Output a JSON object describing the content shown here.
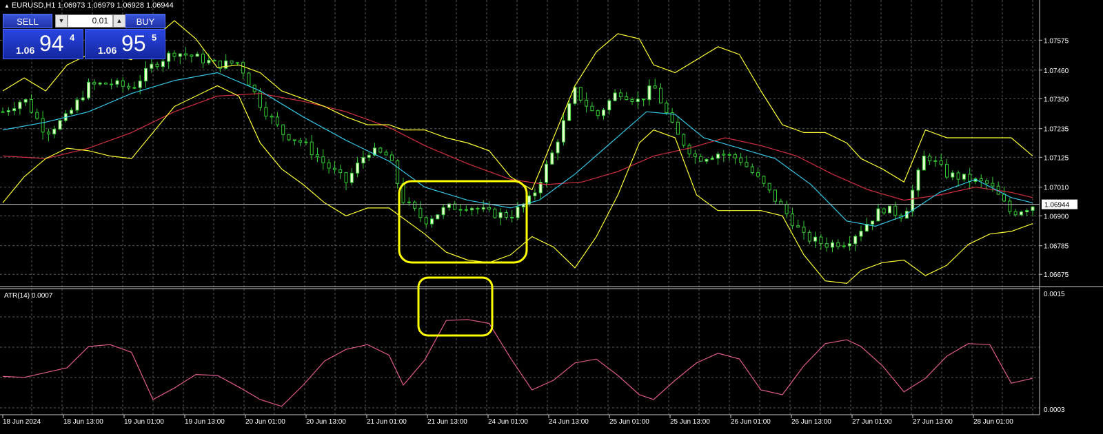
{
  "window": {
    "title": "EURUSD,H1  1.06973 1.06979 1.06928 1.06944",
    "triangle": "▲"
  },
  "trade_panel": {
    "sell_label": "SELL",
    "buy_label": "BUY",
    "lot_value": "0.01",
    "down_arrow": "▼",
    "up_arrow": "▲",
    "sell_price": {
      "prefix": "1.06",
      "big": "94",
      "sup": "4"
    },
    "buy_price": {
      "prefix": "1.06",
      "big": "95",
      "sup": "5"
    }
  },
  "colors": {
    "background": "#000000",
    "grid": "#5a5a5a",
    "bull_candle": "#32cd32",
    "bull_body": "#e8ffd0",
    "bear_candle": "#32cd32",
    "bollinger": "#ffff33",
    "fast_ma": "#33c7e6",
    "slow_ma": "#d42f3f",
    "atr_line": "#e05a8f",
    "highlight_box": "#ffff00",
    "price_line": "#c0c0c0"
  },
  "chart_data": [
    {
      "type": "candlestick",
      "symbol": "EURUSD",
      "timeframe": "H1",
      "ylim": [
        1.0662,
        1.0765
      ],
      "y_ticks": [
        "1.07575",
        "1.07460",
        "1.07350",
        "1.07235",
        "1.07125",
        "1.07010",
        "1.06900",
        "1.06785",
        "1.06675"
      ],
      "current_price": "1.06944",
      "x_ticks": [
        "18 Jun 2024",
        "18 Jun 13:00",
        "19 Jun 01:00",
        "19 Jun 13:00",
        "20 Jun 01:00",
        "20 Jun 13:00",
        "21 Jun 01:00",
        "21 Jun 13:00",
        "24 Jun 01:00",
        "24 Jun 13:00",
        "25 Jun 01:00",
        "25 Jun 13:00",
        "26 Jun 01:00",
        "26 Jun 13:00",
        "27 Jun 01:00",
        "27 Jun 13:00",
        "28 Jun 01:00"
      ],
      "close_path": [
        [
          0,
          1.073
        ],
        [
          6,
          1.0735
        ],
        [
          12,
          1.0722
        ],
        [
          18,
          1.0728
        ],
        [
          24,
          1.074
        ],
        [
          30,
          1.0741
        ],
        [
          36,
          1.0739
        ],
        [
          42,
          1.0748
        ],
        [
          48,
          1.0753
        ],
        [
          54,
          1.0751
        ],
        [
          60,
          1.0748
        ],
        [
          66,
          1.0749
        ],
        [
          72,
          1.0733
        ],
        [
          78,
          1.0722
        ],
        [
          84,
          1.0718
        ],
        [
          90,
          1.071
        ],
        [
          96,
          1.0703
        ],
        [
          102,
          1.0715
        ],
        [
          108,
          1.0713
        ],
        [
          112,
          1.0696
        ],
        [
          118,
          1.0688
        ],
        [
          124,
          1.0693
        ],
        [
          130,
          1.0694
        ],
        [
          136,
          1.0691
        ],
        [
          142,
          1.069
        ],
        [
          148,
          1.0697
        ],
        [
          154,
          1.0715
        ],
        [
          160,
          1.0738
        ],
        [
          166,
          1.0728
        ],
        [
          172,
          1.0738
        ],
        [
          178,
          1.0734
        ],
        [
          182,
          1.074
        ],
        [
          188,
          1.0722
        ],
        [
          194,
          1.0712
        ],
        [
          200,
          1.0714
        ],
        [
          206,
          1.0712
        ],
        [
          212,
          1.0703
        ],
        [
          218,
          1.0693
        ],
        [
          224,
          1.0682
        ],
        [
          230,
          1.0679
        ],
        [
          236,
          1.068
        ],
        [
          240,
          1.0685
        ],
        [
          246,
          1.0693
        ],
        [
          252,
          1.069
        ],
        [
          258,
          1.0714
        ],
        [
          264,
          1.0706
        ],
        [
          270,
          1.0704
        ],
        [
          276,
          1.0702
        ],
        [
          282,
          1.0691
        ],
        [
          288,
          1.0694
        ]
      ],
      "bollinger_upper_path": [
        [
          0,
          1.0738
        ],
        [
          6,
          1.0743
        ],
        [
          12,
          1.0738
        ],
        [
          18,
          1.0748
        ],
        [
          24,
          1.0752
        ],
        [
          30,
          1.0752
        ],
        [
          36,
          1.075
        ],
        [
          42,
          1.0758
        ],
        [
          48,
          1.0765
        ],
        [
          54,
          1.0758
        ],
        [
          60,
          1.0747
        ],
        [
          66,
          1.0748
        ],
        [
          72,
          1.0745
        ],
        [
          78,
          1.0738
        ],
        [
          84,
          1.0735
        ],
        [
          90,
          1.0732
        ],
        [
          96,
          1.0728
        ],
        [
          102,
          1.0725
        ],
        [
          108,
          1.0725
        ],
        [
          112,
          1.0723
        ],
        [
          118,
          1.0723
        ],
        [
          124,
          1.072
        ],
        [
          130,
          1.0718
        ],
        [
          136,
          1.0715
        ],
        [
          142,
          1.0705
        ],
        [
          148,
          1.07
        ],
        [
          154,
          1.072
        ],
        [
          160,
          1.074
        ],
        [
          166,
          1.0753
        ],
        [
          172,
          1.076
        ],
        [
          178,
          1.0758
        ],
        [
          182,
          1.0748
        ],
        [
          188,
          1.0745
        ],
        [
          194,
          1.075
        ],
        [
          200,
          1.0755
        ],
        [
          206,
          1.0752
        ],
        [
          212,
          1.0738
        ],
        [
          218,
          1.0725
        ],
        [
          224,
          1.0722
        ],
        [
          230,
          1.0722
        ],
        [
          236,
          1.0718
        ],
        [
          240,
          1.0712
        ],
        [
          246,
          1.0708
        ],
        [
          252,
          1.0703
        ],
        [
          258,
          1.0723
        ],
        [
          264,
          1.072
        ],
        [
          270,
          1.072
        ],
        [
          276,
          1.072
        ],
        [
          282,
          1.072
        ],
        [
          288,
          1.0713
        ]
      ],
      "bollinger_lower_path": [
        [
          0,
          1.0695
        ],
        [
          6,
          1.0705
        ],
        [
          12,
          1.0712
        ],
        [
          18,
          1.0716
        ],
        [
          24,
          1.0715
        ],
        [
          30,
          1.0713
        ],
        [
          36,
          1.0712
        ],
        [
          42,
          1.0722
        ],
        [
          48,
          1.0732
        ],
        [
          54,
          1.0736
        ],
        [
          60,
          1.074
        ],
        [
          66,
          1.0736
        ],
        [
          72,
          1.0718
        ],
        [
          78,
          1.0708
        ],
        [
          84,
          1.0702
        ],
        [
          90,
          1.0695
        ],
        [
          96,
          1.069
        ],
        [
          102,
          1.0693
        ],
        [
          108,
          1.0693
        ],
        [
          112,
          1.0689
        ],
        [
          118,
          1.0683
        ],
        [
          124,
          1.0676
        ],
        [
          130,
          1.0673
        ],
        [
          136,
          1.0672
        ],
        [
          142,
          1.0675
        ],
        [
          148,
          1.0682
        ],
        [
          154,
          1.0678
        ],
        [
          160,
          1.067
        ],
        [
          166,
          1.0682
        ],
        [
          172,
          1.0698
        ],
        [
          178,
          1.0718
        ],
        [
          182,
          1.0723
        ],
        [
          188,
          1.072
        ],
        [
          194,
          1.0698
        ],
        [
          200,
          1.0692
        ],
        [
          206,
          1.0692
        ],
        [
          212,
          1.0692
        ],
        [
          218,
          1.069
        ],
        [
          224,
          1.0675
        ],
        [
          230,
          1.0665
        ],
        [
          236,
          1.0664
        ],
        [
          240,
          1.0669
        ],
        [
          246,
          1.0672
        ],
        [
          252,
          1.0673
        ],
        [
          258,
          1.0667
        ],
        [
          264,
          1.0671
        ],
        [
          270,
          1.0679
        ],
        [
          276,
          1.0683
        ],
        [
          282,
          1.0684
        ],
        [
          288,
          1.0687
        ]
      ],
      "fast_ma_path": [
        [
          0,
          1.0723
        ],
        [
          12,
          1.0726
        ],
        [
          24,
          1.073
        ],
        [
          36,
          1.0737
        ],
        [
          48,
          1.0742
        ],
        [
          60,
          1.0745
        ],
        [
          72,
          1.0738
        ],
        [
          84,
          1.0728
        ],
        [
          96,
          1.0719
        ],
        [
          108,
          1.0711
        ],
        [
          118,
          1.0701
        ],
        [
          130,
          1.0696
        ],
        [
          142,
          1.0693
        ],
        [
          150,
          1.0696
        ],
        [
          160,
          1.0706
        ],
        [
          170,
          1.0718
        ],
        [
          180,
          1.073
        ],
        [
          188,
          1.0729
        ],
        [
          196,
          1.072
        ],
        [
          206,
          1.0716
        ],
        [
          216,
          1.0712
        ],
        [
          226,
          1.0702
        ],
        [
          236,
          1.0688
        ],
        [
          244,
          1.0686
        ],
        [
          252,
          1.069
        ],
        [
          262,
          1.0699
        ],
        [
          272,
          1.0704
        ],
        [
          282,
          1.0697
        ],
        [
          288,
          1.0695
        ]
      ],
      "slow_ma_path": [
        [
          0,
          1.0713
        ],
        [
          12,
          1.0712
        ],
        [
          24,
          1.0716
        ],
        [
          36,
          1.0722
        ],
        [
          48,
          1.073
        ],
        [
          60,
          1.0736
        ],
        [
          72,
          1.0737
        ],
        [
          84,
          1.0734
        ],
        [
          96,
          1.073
        ],
        [
          108,
          1.0724
        ],
        [
          118,
          1.0717
        ],
        [
          130,
          1.071
        ],
        [
          142,
          1.0704
        ],
        [
          152,
          1.0702
        ],
        [
          162,
          1.0703
        ],
        [
          172,
          1.0707
        ],
        [
          182,
          1.0713
        ],
        [
          192,
          1.0716
        ],
        [
          202,
          1.072
        ],
        [
          212,
          1.0717
        ],
        [
          222,
          1.0713
        ],
        [
          232,
          1.0706
        ],
        [
          242,
          1.07
        ],
        [
          252,
          1.0696
        ],
        [
          262,
          1.0698
        ],
        [
          272,
          1.0701
        ],
        [
          282,
          1.0699
        ],
        [
          288,
          1.0697
        ]
      ]
    },
    {
      "type": "line",
      "name": "ATR(14) 0.0007",
      "ylim": [
        0.0003,
        0.0015
      ],
      "y_ticks": [
        "0.0015",
        "0.0003"
      ],
      "path": [
        [
          0,
          0.00064
        ],
        [
          6,
          0.00063
        ],
        [
          12,
          0.00068
        ],
        [
          18,
          0.00073
        ],
        [
          24,
          0.00095
        ],
        [
          30,
          0.00097
        ],
        [
          36,
          0.00089
        ],
        [
          42,
          0.0004
        ],
        [
          48,
          0.00052
        ],
        [
          54,
          0.00066
        ],
        [
          60,
          0.00065
        ],
        [
          66,
          0.00053
        ],
        [
          72,
          0.0004
        ],
        [
          78,
          0.00033
        ],
        [
          84,
          0.00055
        ],
        [
          90,
          0.0008
        ],
        [
          96,
          0.00092
        ],
        [
          102,
          0.00097
        ],
        [
          108,
          0.00086
        ],
        [
          112,
          0.00055
        ],
        [
          118,
          0.00081
        ],
        [
          124,
          0.00122
        ],
        [
          130,
          0.00123
        ],
        [
          136,
          0.00119
        ],
        [
          142,
          0.00083
        ],
        [
          148,
          0.0005
        ],
        [
          154,
          0.0006
        ],
        [
          160,
          0.00078
        ],
        [
          166,
          0.00082
        ],
        [
          172,
          0.00065
        ],
        [
          178,
          0.00045
        ],
        [
          182,
          0.0004
        ],
        [
          188,
          0.0006
        ],
        [
          194,
          0.00078
        ],
        [
          200,
          0.00088
        ],
        [
          206,
          0.00082
        ],
        [
          212,
          0.0005
        ],
        [
          218,
          0.00045
        ],
        [
          224,
          0.00075
        ],
        [
          230,
          0.00098
        ],
        [
          236,
          0.00102
        ],
        [
          240,
          0.00095
        ],
        [
          246,
          0.00075
        ],
        [
          252,
          0.00048
        ],
        [
          258,
          0.00062
        ],
        [
          264,
          0.00085
        ],
        [
          270,
          0.00098
        ],
        [
          276,
          0.00097
        ],
        [
          282,
          0.00057
        ],
        [
          288,
          0.00062
        ]
      ]
    }
  ]
}
